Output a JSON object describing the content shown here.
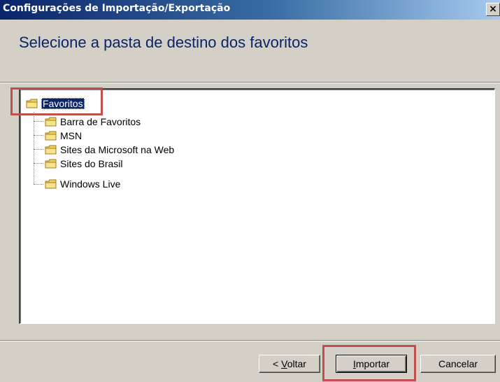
{
  "window": {
    "title": "Configurações de Importação/Exportação",
    "close_glyph": "×"
  },
  "header": {
    "heading": "Selecione a pasta de destino dos favoritos"
  },
  "tree": {
    "root": {
      "label": "Favoritos",
      "icon": "folder-icon",
      "selected": true
    },
    "children": [
      {
        "label": "Barra de Favoritos",
        "icon": "folder-icon"
      },
      {
        "label": "MSN",
        "icon": "folder-icon"
      },
      {
        "label": "Sites da Microsoft na Web",
        "icon": "folder-icon"
      },
      {
        "label": "Sites do Brasil",
        "icon": "folder-icon"
      },
      {
        "label": "Windows Live",
        "icon": "folder-icon"
      }
    ]
  },
  "buttons": {
    "back": {
      "prefix": "< ",
      "mnemonic": "V",
      "rest": "oltar"
    },
    "import": {
      "mnemonic": "I",
      "rest": "mportar"
    },
    "cancel": {
      "label": "Cancelar"
    }
  },
  "colors": {
    "title_bar": "#0a246a",
    "heading_text": "#0a246a",
    "highlight_box": "#c0504d",
    "dialog_face": "#d4d0c8"
  }
}
